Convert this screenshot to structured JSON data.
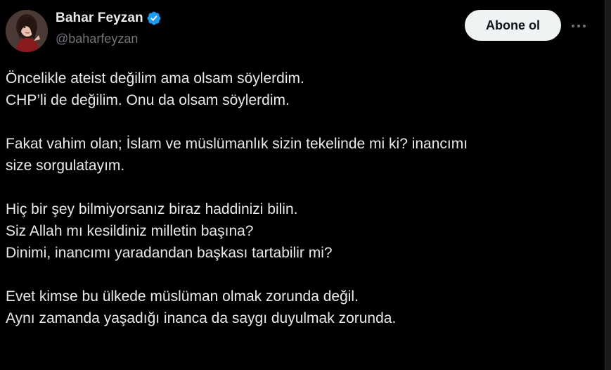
{
  "colors": {
    "background": "#000000",
    "text": "#e7e9ea",
    "secondary_text": "#71767b",
    "verified_blue": "#1d9bf0",
    "button_bg": "#eff3f4",
    "button_text": "#0f1419"
  },
  "author": {
    "display_name": "Bahar Feyzan",
    "handle": "@baharfeyzan",
    "verified_icon": "verified-badge-icon",
    "avatar_icon": "profile-avatar"
  },
  "actions": {
    "follow_label": "Abone ol",
    "more_icon": "more-horizontal-icon"
  },
  "tweet": {
    "paragraphs": [
      {
        "lines": [
          "Öncelikle ateist değilim ama olsam söylerdim.",
          "CHP’li de değilim. Onu da olsam söylerdim."
        ]
      },
      {
        "lines": [
          "Fakat vahim olan; İslam ve müslümanlık sizin tekelinde mi ki? inancımı",
          "size sorgulatayım."
        ]
      },
      {
        "lines": [
          "Hiç bir şey bilmiyorsanız biraz haddinizi bilin.",
          "Siz Allah mı kesildiniz milletin başına?",
          "Dinimi, inancımı yaradandan başkası tartabilir mi?"
        ]
      },
      {
        "lines": [
          "Evet kimse bu ülkede müslüman olmak zorunda değil.",
          "Aynı zamanda yaşadığı inanca da saygı duyulmak zorunda."
        ]
      }
    ]
  }
}
